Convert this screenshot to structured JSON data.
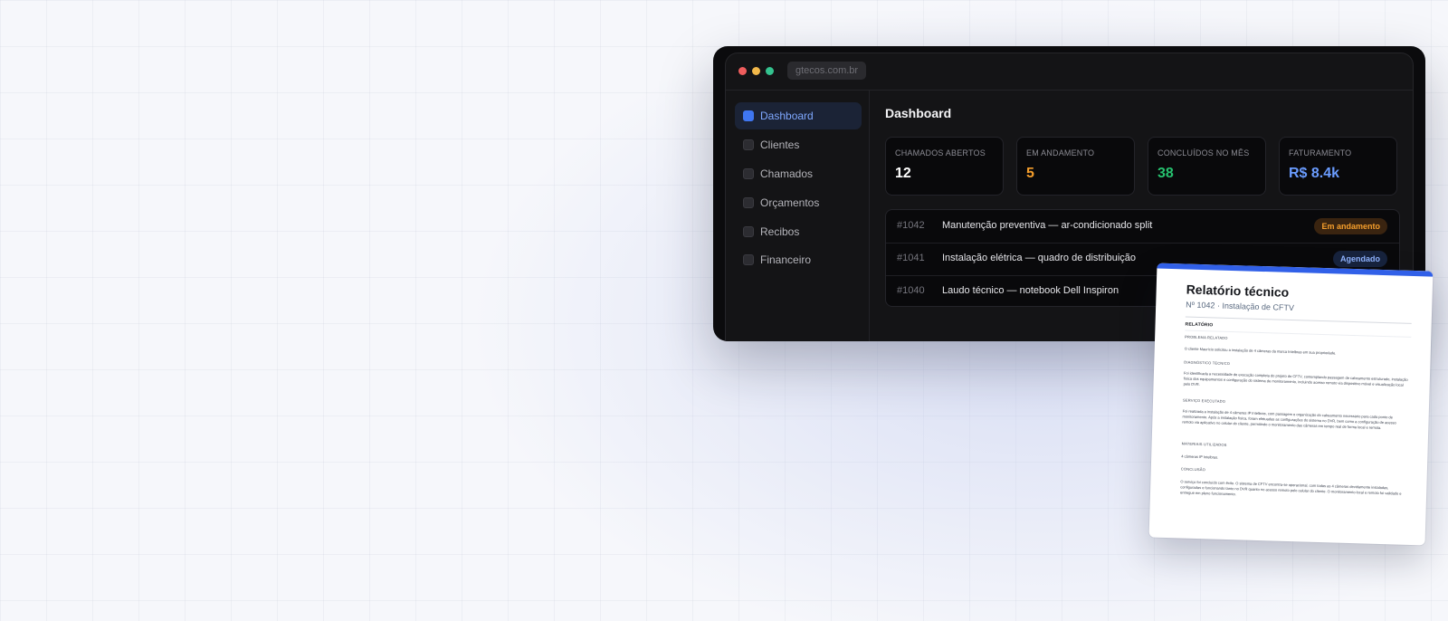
{
  "browser": {
    "url": "gtecos.com.br"
  },
  "sidebar": {
    "items": [
      {
        "label": "Dashboard",
        "active": true
      },
      {
        "label": "Clientes"
      },
      {
        "label": "Chamados"
      },
      {
        "label": "Orçamentos"
      },
      {
        "label": "Recibos"
      },
      {
        "label": "Financeiro"
      }
    ]
  },
  "dashboard": {
    "title": "Dashboard",
    "stats": [
      {
        "label": "CHAMADOS ABERTOS",
        "value": "12",
        "color": "#ffffff"
      },
      {
        "label": "EM ANDAMENTO",
        "value": "5",
        "color": "#f59e2c"
      },
      {
        "label": "CONCLUÍDOS NO MÊS",
        "value": "38",
        "color": "#26c26f"
      },
      {
        "label": "FATURAMENTO",
        "value": "R$ 8.4k",
        "color": "#6a9cff"
      }
    ],
    "tickets": [
      {
        "id": "#1042",
        "title": "Manutenção preventiva — ar-condicionado split",
        "status": "Em andamento",
        "status_color": "#f59e2c",
        "status_bg": "#3a2410"
      },
      {
        "id": "#1041",
        "title": "Instalação elétrica — quadro de distribuição",
        "status": "Agendado",
        "status_color": "#8fb3ff",
        "status_bg": "#17233d"
      },
      {
        "id": "#1040",
        "title": "Laudo técnico — notebook Dell Inspiron",
        "status": "",
        "status_color": "#ffffff",
        "status_bg": "transparent"
      }
    ]
  },
  "report": {
    "title": "Relatório técnico",
    "subtitle": "Nº 1042 · Instalação de CFTV",
    "section": "RELATÓRIO",
    "blocks": [
      {
        "heading": "PROBLEMA RELATADO",
        "text": "O cliente Maurício solicitou a instalação de 4 câmeras da marca Intelbras em sua propriedade."
      },
      {
        "heading": "DIAGNÓSTICO TÉCNICO",
        "text": "Foi identificada a necessidade de execução completa do projeto de CFTV, contemplando passagem de cabeamento estruturado, instalação física dos equipamentos e configuração do sistema de monitoramento, incluindo acesso remoto via dispositivo móvel e visualização local pelo DVR."
      },
      {
        "heading": "SERVIÇO EXECUTADO",
        "text": "Foi realizada a instalação de 4 câmeras IP Intelbras, com passagem e organização do cabeamento necessário para cada ponto de monitoramento. Após a instalação física, foram efetuadas as configurações do sistema no DVR, bem como a configuração de acesso remoto via aplicativo no celular do cliente, permitindo o monitoramento das câmeras em tempo real de forma local e remota."
      },
      {
        "heading": "MATERIAIS UTILIZADOS",
        "text": "4 câmeras IP Intelbras."
      },
      {
        "heading": "CONCLUSÃO",
        "text": "O serviço foi concluído com êxito. O sistema de CFTV encontra-se operacional, com todas as 4 câmeras devidamente instaladas, configuradas e funcionando tanto no DVR quanto no acesso remoto pelo celular do cliente. O monitoramento local e remoto foi validado e entregue em pleno funcionamento."
      }
    ]
  }
}
